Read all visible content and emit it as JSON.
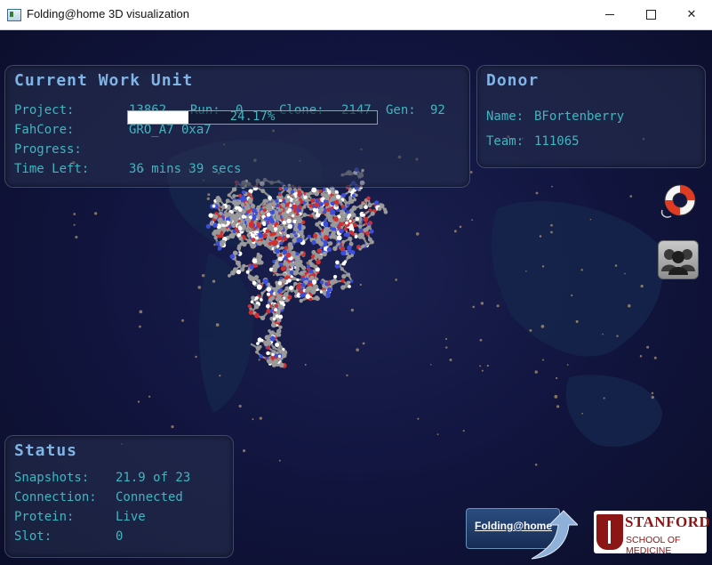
{
  "window": {
    "title": "Folding@home 3D visualization"
  },
  "work_unit": {
    "heading": "Current Work Unit",
    "project_label": "Project:",
    "project": "13862",
    "run_label": "Run:",
    "run": "0",
    "clone_label": "Clone:",
    "clone": "2147",
    "gen_label": "Gen:",
    "gen": "92",
    "fahcore_label": "FahCore:",
    "fahcore": "GRO_A7 0xa7",
    "progress_label": "Progress:",
    "progress_text": "24.17%",
    "progress_fraction": 0.2417,
    "time_left_label": "Time Left:",
    "time_left": "36 mins 39 secs"
  },
  "donor": {
    "heading": "Donor",
    "name_label": "Name:",
    "name": "BFortenberry",
    "team_label": "Team:",
    "team": "111065"
  },
  "status": {
    "heading": "Status",
    "snapshots_label": "Snapshots:",
    "snapshots": "21.9 of 23",
    "connection_label": "Connection:",
    "connection": "Connected",
    "protein_label": "Protein:",
    "protein": "Live",
    "slot_label": "Slot:",
    "slot": "0"
  },
  "logos": {
    "fah": "Folding@home",
    "stanford_name": "STANFORD",
    "stanford_school": "SCHOOL OF MEDICINE"
  },
  "icons": {
    "help": "lifebuoy-icon",
    "donors": "people-group-icon"
  },
  "colors": {
    "panel_text": "#3fb6c0",
    "heading": "#7fb4e6",
    "atom_carbon": "#9a9a9a",
    "atom_nitrogen": "#3d4fd8",
    "atom_oxygen": "#d03030"
  }
}
